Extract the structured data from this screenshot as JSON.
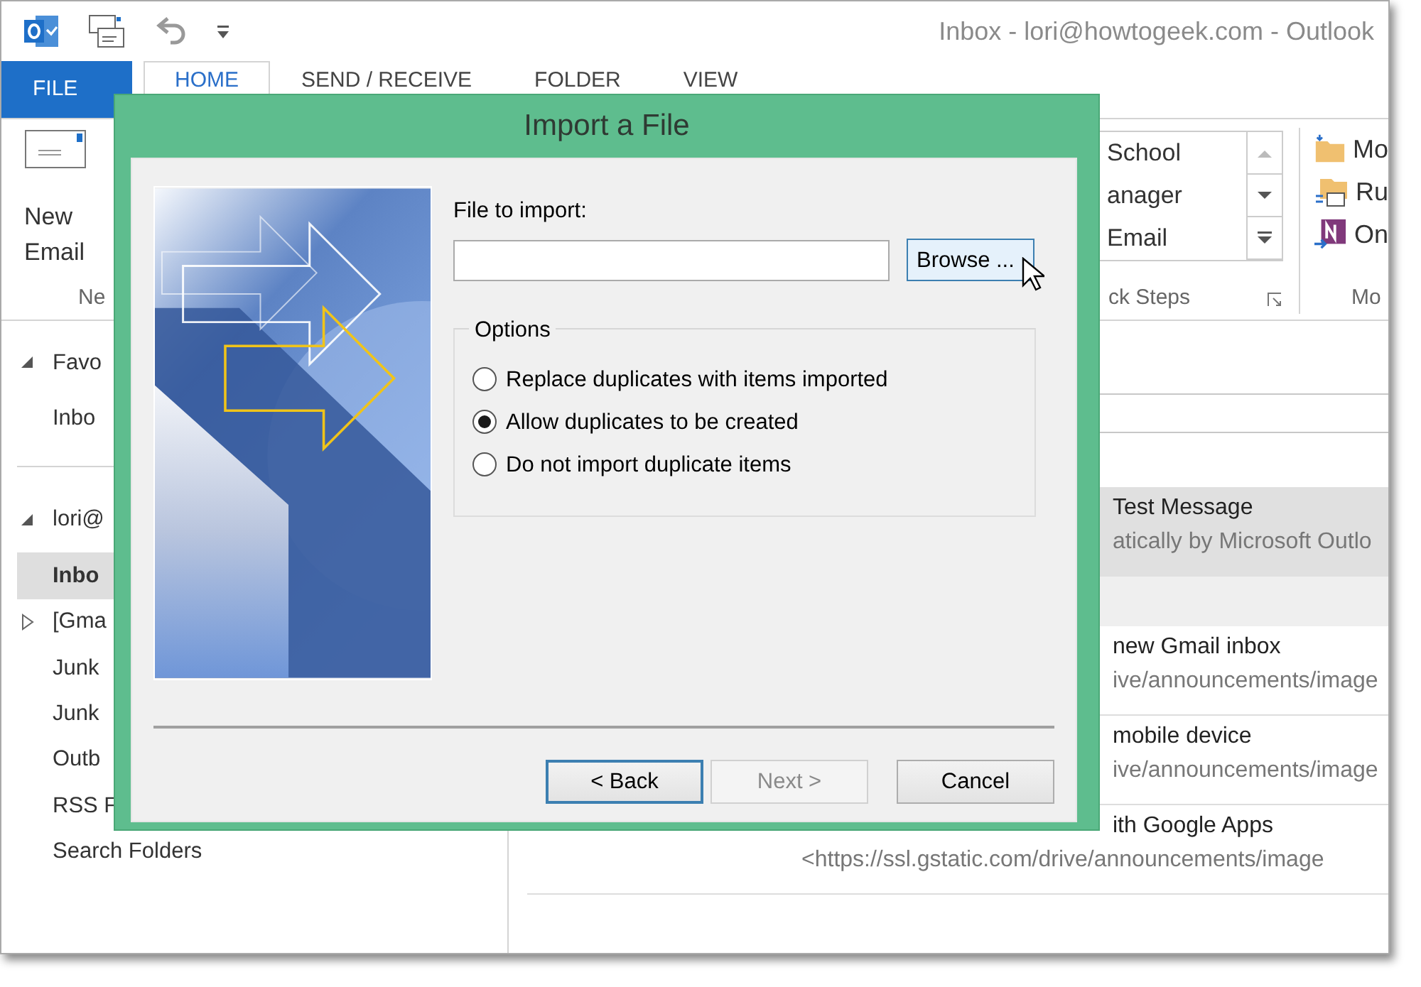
{
  "window": {
    "title": "Inbox - lori@howtogeek.com - Outlook"
  },
  "ribbon_tabs": [
    {
      "label": "FILE",
      "kind": "file",
      "selected": false
    },
    {
      "label": "HOME",
      "kind": "tab",
      "selected": true
    },
    {
      "label": "SEND / RECEIVE",
      "kind": "tab",
      "selected": false
    },
    {
      "label": "FOLDER",
      "kind": "tab",
      "selected": false
    },
    {
      "label": "VIEW",
      "kind": "tab",
      "selected": false
    }
  ],
  "ribbon": {
    "new_email": {
      "label": "New Email",
      "group_label": "Ne"
    },
    "quick_steps": {
      "items": [
        "School",
        "anager",
        "Email"
      ],
      "group_label": "ck Steps"
    },
    "move": {
      "items": [
        "Mo",
        "Ru",
        "On"
      ],
      "group_label": "Mo"
    }
  },
  "folders": [
    {
      "label": "Favo",
      "expanded": true,
      "selected": false,
      "children": [
        {
          "label": "Inbo",
          "selected": false
        }
      ]
    },
    {
      "label": "lori@",
      "expanded": true,
      "selected": false,
      "children": [
        {
          "label": "Inbo",
          "selected": true
        },
        {
          "label": "[Gma",
          "expanded": false,
          "selected": false
        },
        {
          "label": "Junk",
          "selected": false
        },
        {
          "label": "Junk",
          "selected": false
        },
        {
          "label": "Outb",
          "selected": false
        },
        {
          "label": "RSS F",
          "selected": false
        },
        {
          "label": "Search Folders",
          "selected": false
        }
      ]
    }
  ],
  "messages": [
    {
      "subject": "Test Message",
      "preview": "atically by Microsoft Outlo",
      "selected": true
    },
    {
      "subject": "new Gmail inbox",
      "preview": "ive/announcements/image",
      "selected": false
    },
    {
      "subject": "mobile device",
      "preview": "ive/announcements/image",
      "selected": false
    },
    {
      "subject": "ith Google Apps",
      "preview": "<https://ssl.gstatic.com/drive/announcements/image",
      "selected": false
    }
  ],
  "dialog": {
    "title": "Import a File",
    "file_label": "File to import:",
    "browse": {
      "label": "Browse ...",
      "hovered": true
    },
    "options_legend": "Options",
    "options": [
      {
        "label": "Replace duplicates with items imported",
        "selected": false
      },
      {
        "label": "Allow duplicates to be created",
        "selected": true
      },
      {
        "label": "Do not import duplicate items",
        "selected": false
      }
    ],
    "buttons": [
      {
        "label": "< Back",
        "kind": "default",
        "disabled": false
      },
      {
        "label": "Next >",
        "kind": "normal",
        "disabled": true
      },
      {
        "label": "Cancel",
        "kind": "normal",
        "disabled": false
      }
    ]
  }
}
